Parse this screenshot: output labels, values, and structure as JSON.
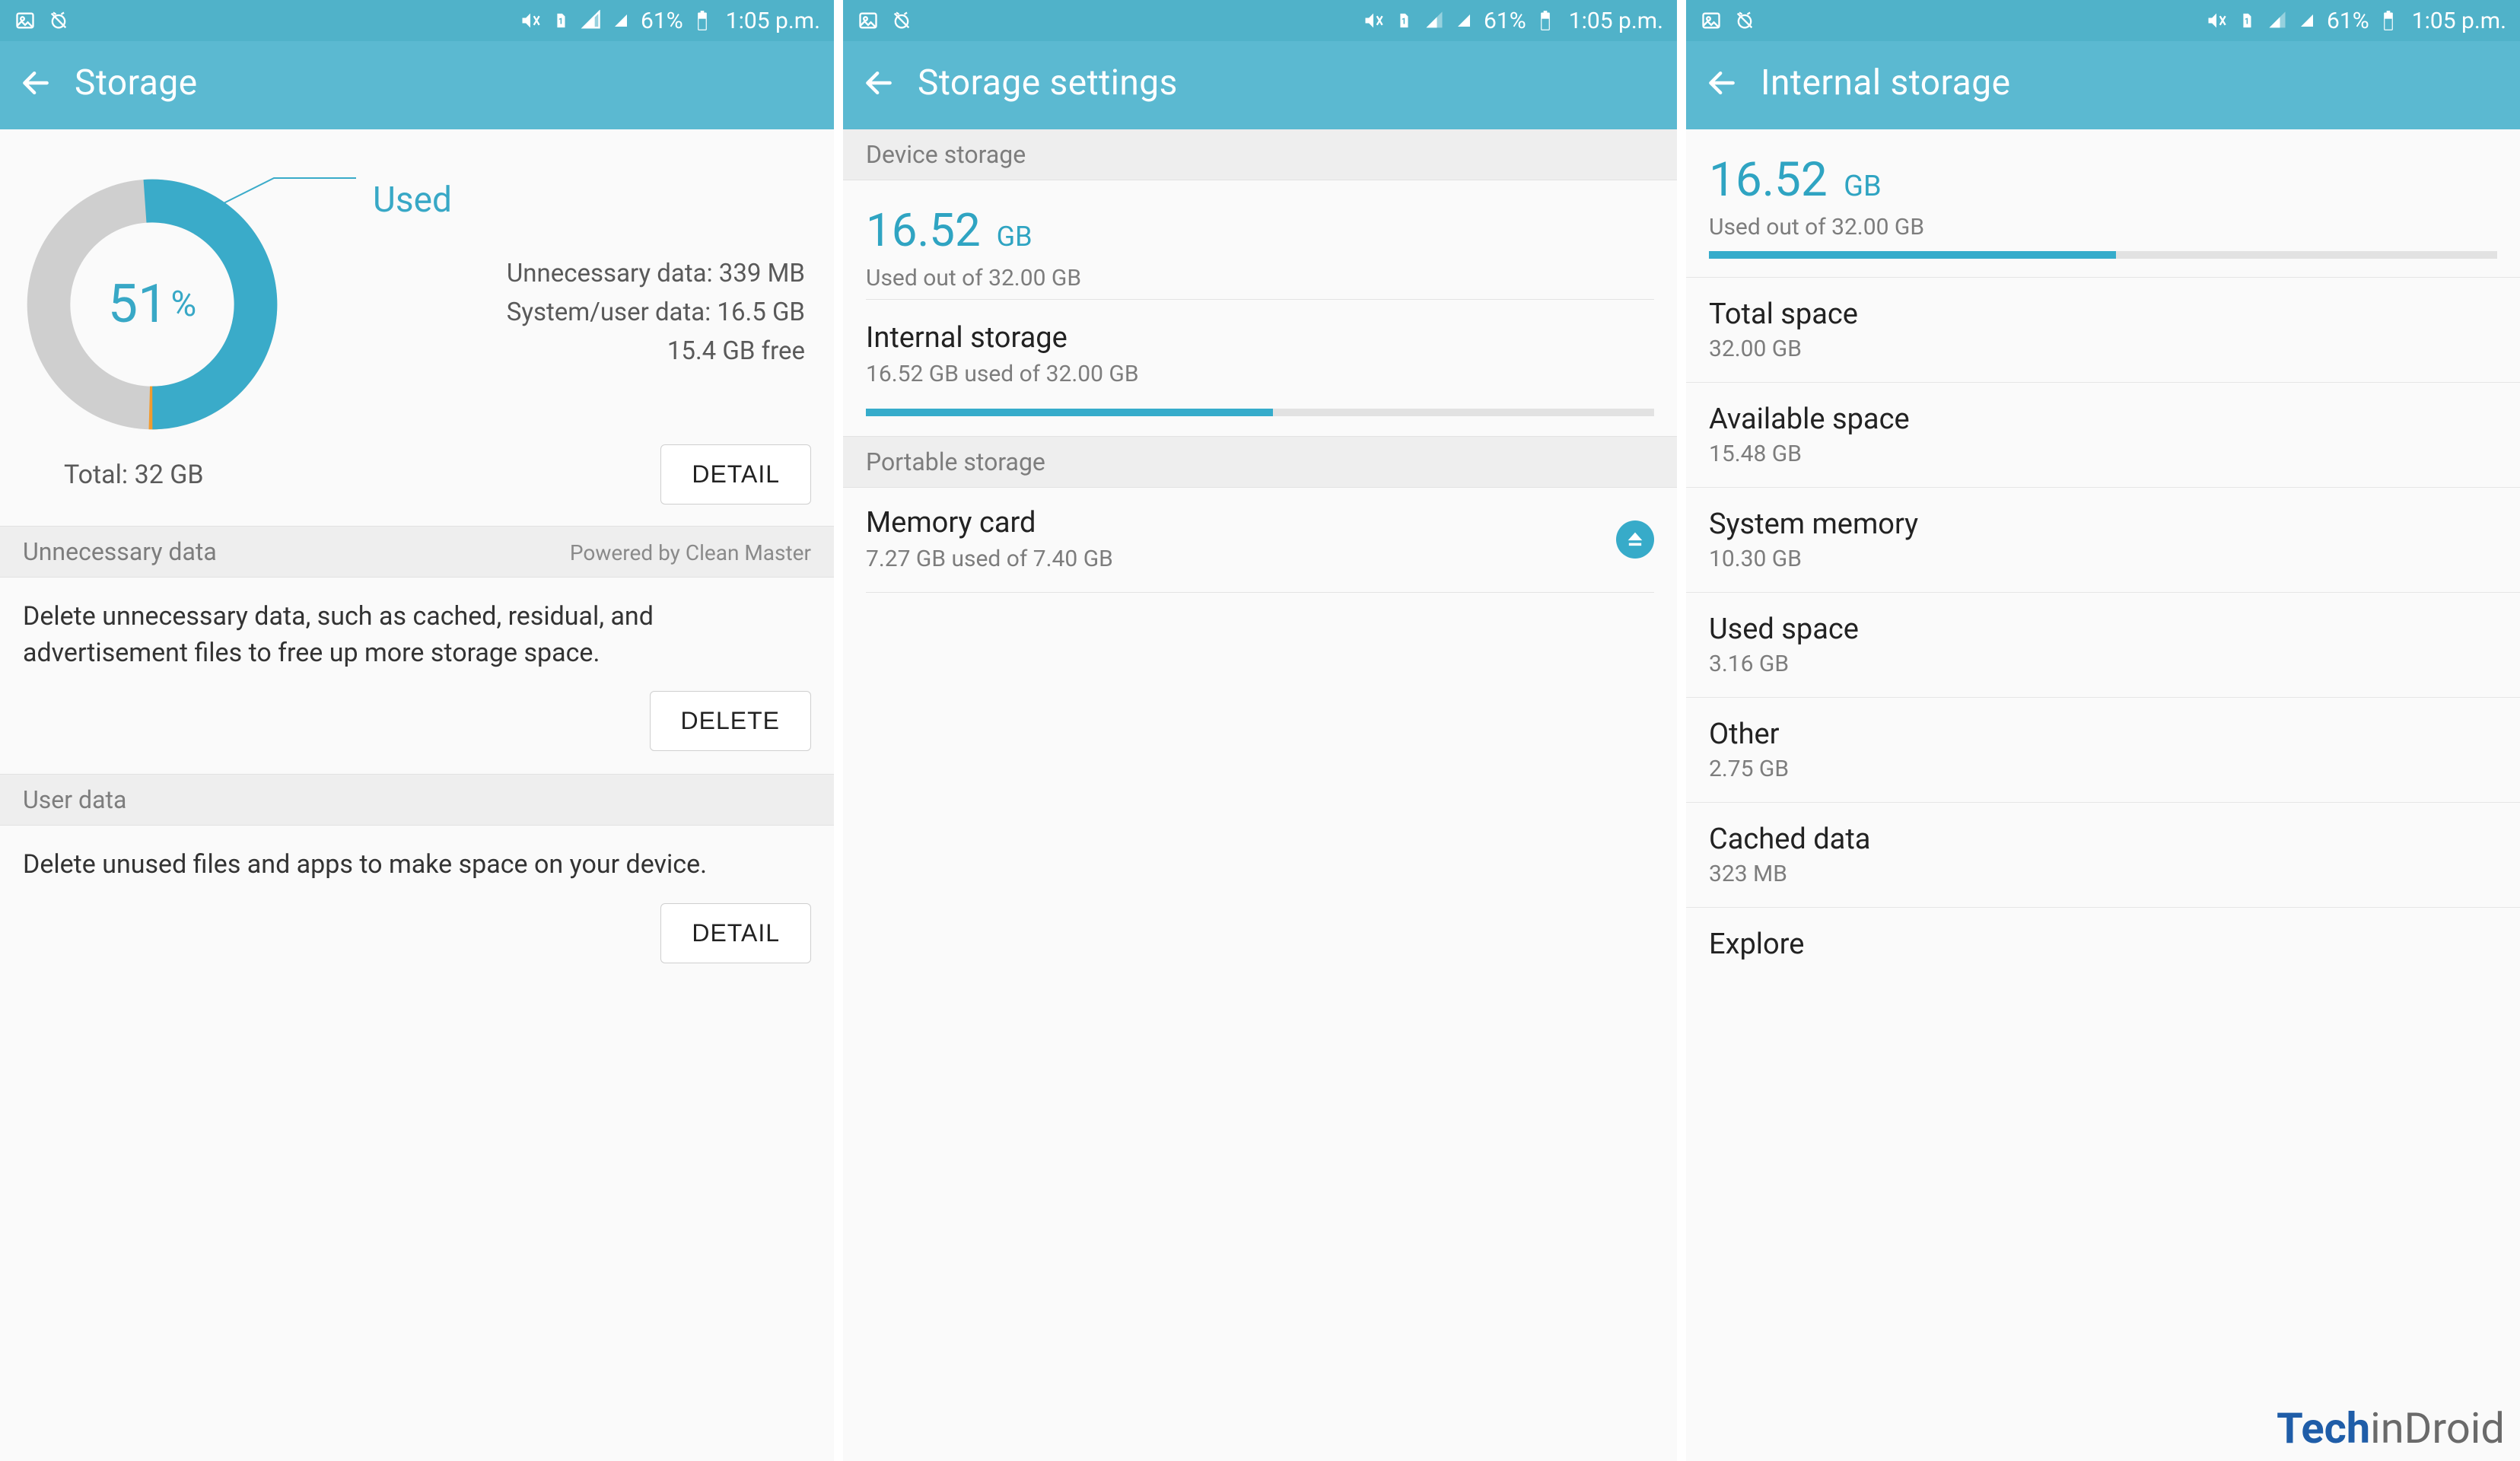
{
  "status": {
    "battery_pct": "61%",
    "time": "1:05 p.m."
  },
  "screen1": {
    "title": "Storage",
    "donut": {
      "used_pct_num": "51",
      "used_pct_sign": "%",
      "used_label": "Used",
      "unnecessary_line": "Unnecessary data: 339 MB",
      "sysuser_line": "System/user data: 16.5 GB",
      "free_line": "15.4 GB free",
      "total_line": "Total: 32 GB",
      "detail_btn": "DETAIL"
    },
    "unnecessary": {
      "header": "Unnecessary data",
      "powered": "Powered by Clean Master",
      "body": "Delete unnecessary data, such as cached, residual, and advertisement files to free up more storage space.",
      "delete_btn": "DELETE"
    },
    "userdata": {
      "header": "User data",
      "body": "Delete unused files and apps to make space on your device.",
      "detail_btn": "DETAIL"
    }
  },
  "screen2": {
    "title": "Storage settings",
    "device_header": "Device storage",
    "amount_num": "16.52",
    "amount_unit": "GB",
    "amount_sub": "Used out of 32.00 GB",
    "internal": {
      "title": "Internal storage",
      "sub": "16.52 GB used of 32.00 GB",
      "pct": 51.6
    },
    "portable_header": "Portable storage",
    "memcard": {
      "title": "Memory card",
      "sub": "7.27 GB used of 7.40 GB"
    }
  },
  "screen3": {
    "title": "Internal storage",
    "amount_num": "16.52",
    "amount_unit": "GB",
    "amount_sub": "Used out of 32.00 GB",
    "pct": 51.6,
    "items": [
      {
        "t": "Total space",
        "s": "32.00 GB"
      },
      {
        "t": "Available space",
        "s": "15.48 GB"
      },
      {
        "t": "System memory",
        "s": "10.30 GB"
      },
      {
        "t": "Used space",
        "s": "3.16 GB"
      },
      {
        "t": "Other",
        "s": "2.75 GB"
      },
      {
        "t": "Cached data",
        "s": "323 MB"
      },
      {
        "t": "Explore",
        "s": ""
      }
    ]
  },
  "watermark": {
    "a": "Tech",
    "b": "inDroid"
  },
  "chart_data": {
    "type": "pie",
    "title": "Storage used",
    "categories": [
      "Used",
      "Free",
      "Other"
    ],
    "values": [
      51,
      48,
      1
    ],
    "colors": [
      "#3aabc9",
      "#cfcfcf",
      "#f29b2e"
    ],
    "center_label": "51%",
    "total_gb": 32,
    "used_gb": 16.5,
    "free_gb": 15.4,
    "unnecessary_mb": 339
  }
}
